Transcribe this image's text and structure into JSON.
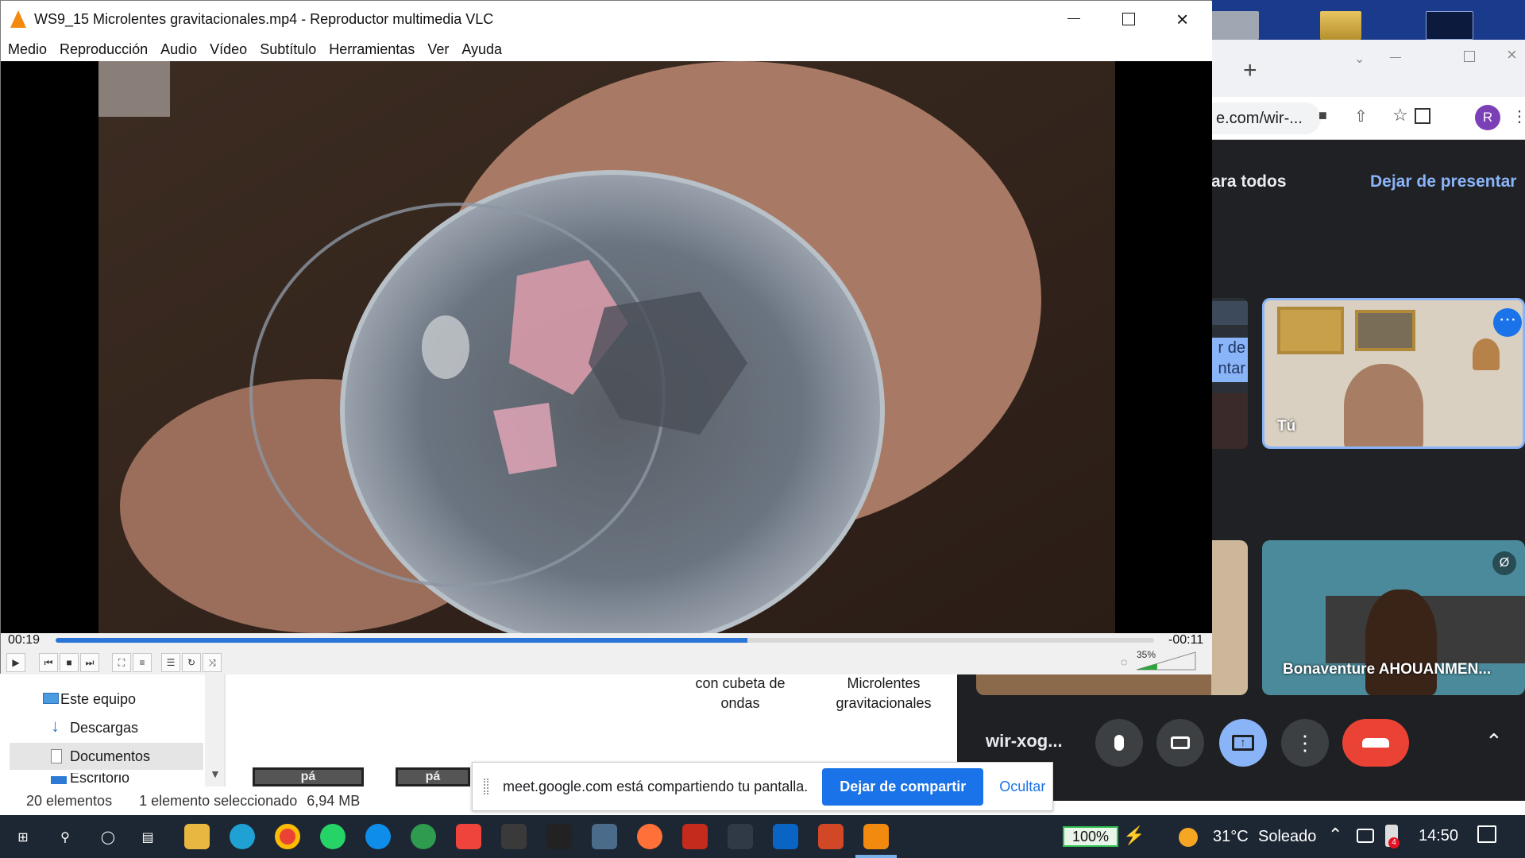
{
  "vlc": {
    "title": "WS9_15 Microlentes gravitacionales.mp4 - Reproductor multimedia VLC",
    "menu": [
      "Medio",
      "Reproducción",
      "Audio",
      "Vídeo",
      "Subtítulo",
      "Herramientas",
      "Ver",
      "Ayuda"
    ],
    "time_elapsed": "00:19",
    "time_remaining": "-00:11",
    "progress": 0.63,
    "volume": "35%",
    "volume_level": 0.35
  },
  "chrome": {
    "address": "e.com/wir-...",
    "profile_initial": "R",
    "new_tab": "+"
  },
  "meet": {
    "present_text": "ara todos",
    "stop_presenting": "Dejar de presentar",
    "presenting_fragment_1": "r de",
    "presenting_fragment_2": "ntar",
    "self_label": "Tú",
    "participant_name": "Bonaventure AHOUANMEN...",
    "meeting_code": "wir-xog...",
    "accent_color": "#8ab4f8",
    "end_call_color": "#ea4335"
  },
  "explorer": {
    "nav": [
      "Este equipo",
      "Descargas",
      "Documentos",
      "Escritorio"
    ],
    "files": [
      {
        "name_line1": "con cubeta de",
        "name_line2": "ondas"
      },
      {
        "name_line1": "Microlentes",
        "name_line2": "gravitacionales"
      }
    ],
    "thumb_label": "pá",
    "status_count": "20 elementos",
    "status_selected": "1 elemento seleccionado",
    "status_size": "6,94 MB"
  },
  "share_banner": {
    "message": "meet.google.com está compartiendo tu pantalla.",
    "stop_button": "Dejar de compartir",
    "hide_button": "Ocultar"
  },
  "taskbar": {
    "battery": "100%",
    "temperature": "31°C",
    "weather": "Soleado",
    "time": "14:50",
    "notification_count": "4"
  }
}
